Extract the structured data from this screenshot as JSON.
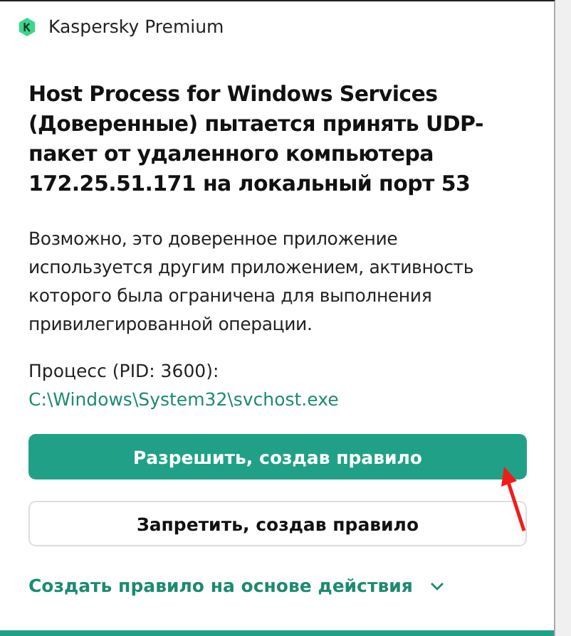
{
  "window": {
    "title": "Kaspersky Premium"
  },
  "heading": "Host Process for Windows Services (Доверенные) пытается принять UDP-пакет от удаленного компьютера 172.25.51.171 на локальный порт 53",
  "description": "Возможно, это доверенное приложение используется другим приложением, активность которого была ограничена для выполнения привилегированной операции.",
  "process": {
    "label": "Процесс (PID: 3600):",
    "path": "C:\\Windows\\System32\\svchost.exe"
  },
  "buttons": [
    {
      "label": "Разрешить, создав правило",
      "kind": "primary"
    },
    {
      "label": "Запретить, создав правило",
      "kind": "secondary"
    }
  ],
  "rule_link": {
    "label": "Создать правило на основе действия",
    "expanded": false
  }
}
